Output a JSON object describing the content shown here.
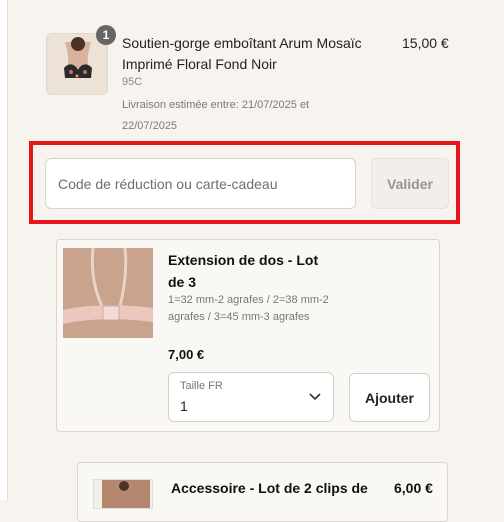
{
  "cart_item": {
    "quantity": "1",
    "title": "Soutien-gorge emboîtant Arum Mosaïc Imprimé Floral Fond Noir",
    "price": "15,00 €",
    "variant": "95C",
    "shipping": "Livraison estimée entre: 21/07/2025 et 22/07/2025"
  },
  "discount": {
    "placeholder": "Code de réduction ou carte-cadeau",
    "button": "Valider"
  },
  "upsells": [
    {
      "title": "Extension de dos - Lot de 3",
      "description": "1=32 mm-2 agrafes / 2=38 mm-2 agrafes / 3=45 mm-3 agrafes",
      "price": "7,00 €",
      "size_label": "Taille FR",
      "size_value": "1",
      "add_button": "Ajouter"
    },
    {
      "title": "Accessoire - Lot de 2 clips de",
      "price": "6,00 €"
    }
  ],
  "colors": {
    "highlight": "#e8141b",
    "background": "#f7f3ee"
  }
}
